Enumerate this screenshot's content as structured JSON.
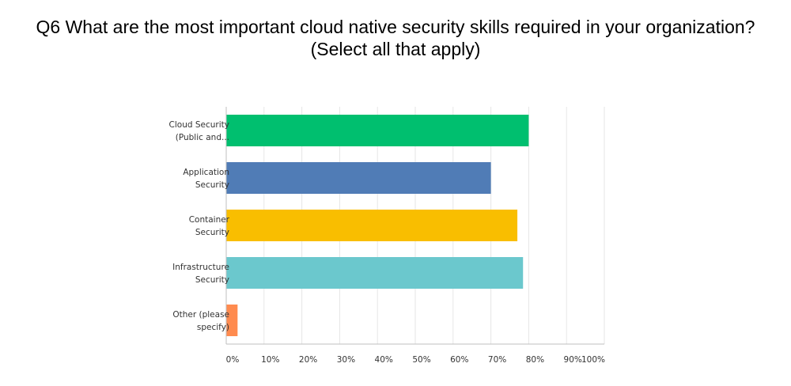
{
  "title": {
    "line1": "Q6 What are the most important cloud native security skills required in your organization?",
    "line2": "(Select all that apply)"
  },
  "chart_data": {
    "type": "bar",
    "orientation": "horizontal",
    "title": "Q6 What are the most important cloud native security skills required in your organization? (Select all that apply)",
    "categories": [
      [
        "Cloud Security",
        "(Public and..."
      ],
      [
        "Application",
        "Security"
      ],
      [
        "Container",
        "Security"
      ],
      [
        "Infrastructure",
        "Security"
      ],
      [
        "Other (please",
        "specify)"
      ]
    ],
    "values": [
      80,
      70,
      77,
      78.5,
      3
    ],
    "colors": [
      "#00bf6f",
      "#507cb6",
      "#f9be00",
      "#6bc8cd",
      "#ff8b4f"
    ],
    "xlim": [
      0,
      100
    ],
    "x_ticks": [
      "0%",
      "10%",
      "20%",
      "30%",
      "40%",
      "50%",
      "60%",
      "70%",
      "80%",
      "90%",
      "100%"
    ],
    "grid": true,
    "legend": "none"
  }
}
